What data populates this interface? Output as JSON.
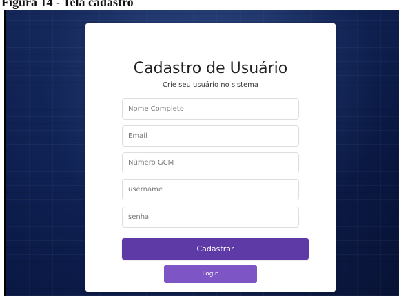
{
  "figure": {
    "caption": "Figura 14 - Tela cadastro"
  },
  "registration": {
    "title": "Cadastro de Usuário",
    "subtitle": "Crie seu usuário no sistema",
    "fields": {
      "full_name": {
        "value": "",
        "placeholder": "Nome Completo"
      },
      "email": {
        "value": "",
        "placeholder": "Email"
      },
      "gcm_number": {
        "value": "",
        "placeholder": "Número GCM"
      },
      "username": {
        "value": "",
        "placeholder": "username"
      },
      "password": {
        "value": "",
        "placeholder": "senha"
      }
    },
    "buttons": {
      "register_label": "Cadastrar",
      "login_label": "Login"
    }
  },
  "theme": {
    "background_color": "#0f235a",
    "card_color": "#ffffff",
    "primary_button_color": "#5e3aa7",
    "secondary_button_color": "#7d55c4"
  }
}
